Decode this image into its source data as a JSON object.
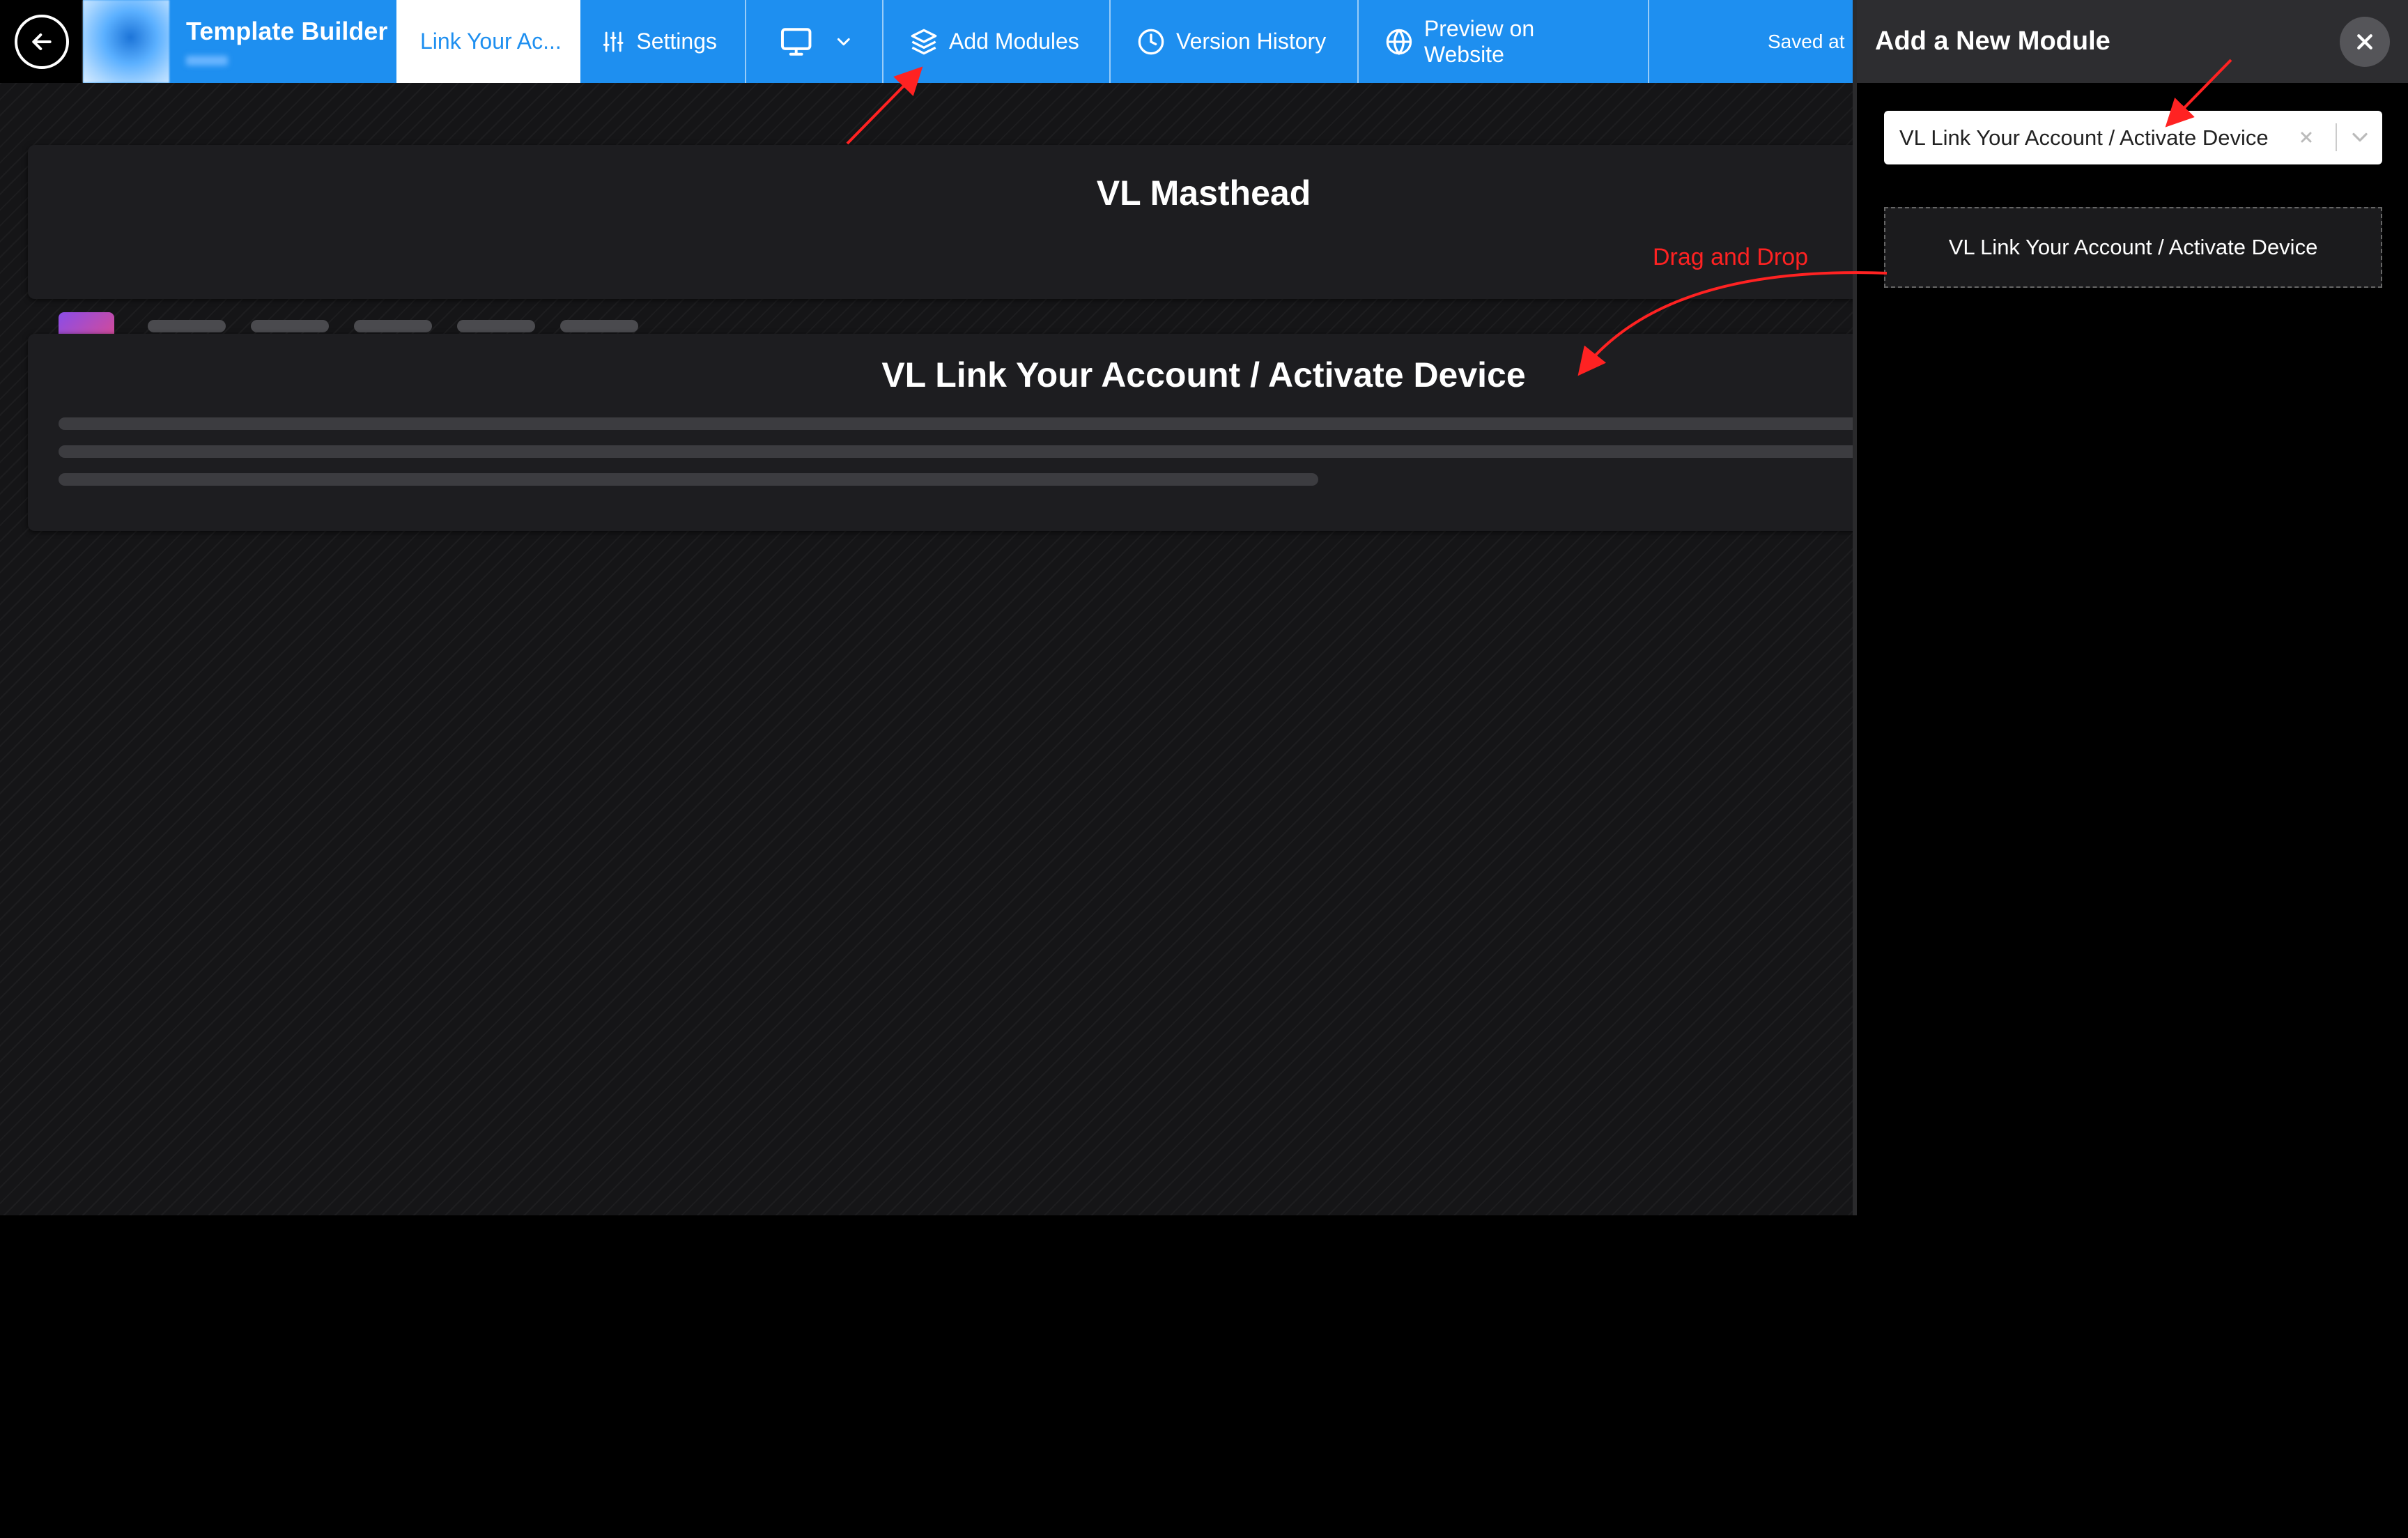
{
  "topbar": {
    "brand_title": "Template Builder",
    "active_tab_label": "Link Your Ac...",
    "settings_label": "Settings",
    "add_modules_label": "Add Modules",
    "version_history_label": "Version History",
    "preview_label": "Preview on Website",
    "saved_text": "Saved at",
    "accent_color": "#1e8ff0"
  },
  "canvas": {
    "masthead_title": "VL Masthead",
    "link_module_title": "VL Link Your Account / Activate Device"
  },
  "panel": {
    "title": "Add a New Module",
    "select_value": "VL Link Your Account / Activate Device",
    "draggable_module_label": "VL Link Your Account / Activate Device"
  },
  "annotation": {
    "drag_note": "Drag and Drop",
    "color": "#ff2222"
  },
  "icons": [
    "arrow-left-icon",
    "sliders-icon",
    "monitor-icon",
    "chevron-down-icon",
    "layers-icon",
    "clock-icon",
    "globe-icon",
    "close-icon",
    "clear-icon"
  ]
}
